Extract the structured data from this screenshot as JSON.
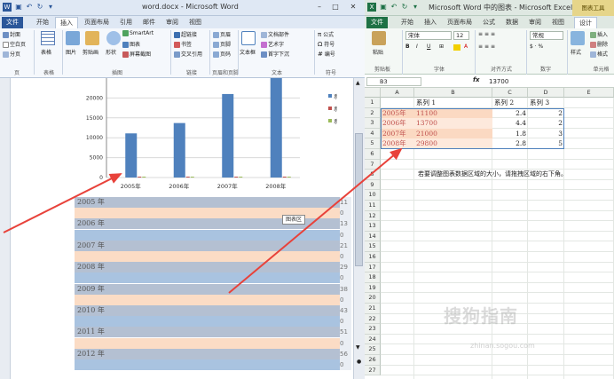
{
  "word": {
    "title": "word.docx - Microsoft Word",
    "tabs": [
      "文件",
      "开始",
      "插入",
      "页面布局",
      "引用",
      "邮件",
      "审阅",
      "视图"
    ],
    "active_tab": "插入",
    "ribbon": {
      "pages": {
        "items": [
          "封面",
          "空白页",
          "分页"
        ],
        "label": "页"
      },
      "table": {
        "items": [
          "表格"
        ],
        "label": "表格"
      },
      "illustrations": {
        "items": [
          "图片",
          "剪贴画",
          "形状",
          "SmartArt",
          "图表",
          "屏幕截图"
        ],
        "label": "插图"
      },
      "links": {
        "items": [
          "超链接",
          "书签",
          "交叉引用"
        ],
        "label": "链接"
      },
      "header_footer": {
        "items": [
          "页眉",
          "页脚",
          "页码"
        ],
        "label": "页眉和页脚"
      },
      "text": {
        "items": [
          "文本框",
          "文档部件",
          "艺术字",
          "首字下沉"
        ],
        "label": "文本"
      },
      "symbols": {
        "items": [
          "公式",
          "符号",
          "编号"
        ],
        "label": "符号"
      }
    },
    "chart": {
      "y_ticks": [
        "20000",
        "15000",
        "10000",
        "5000",
        "0"
      ],
      "x_ticks": [
        "2005年",
        "2006年",
        "2007年",
        "2008年"
      ]
    },
    "table_rows": [
      {
        "label": "2005 年",
        "right": "11"
      },
      {
        "label": "",
        "right": "0"
      },
      {
        "label": "2006 年",
        "right": "13"
      },
      {
        "label": "",
        "right": "0"
      },
      {
        "label": "2007 年",
        "right": "21"
      },
      {
        "label": "",
        "right": "0"
      },
      {
        "label": "2008 年",
        "right": "29"
      },
      {
        "label": "",
        "right": "0"
      },
      {
        "label": "2009 年",
        "right": "38"
      },
      {
        "label": "",
        "right": "0"
      },
      {
        "label": "2010 年",
        "right": "43"
      },
      {
        "label": "",
        "right": "0"
      },
      {
        "label": "2011 年",
        "right": "51"
      },
      {
        "label": "",
        "right": "0"
      },
      {
        "label": "2012 年",
        "right": "56"
      },
      {
        "label": "",
        "right": "0"
      }
    ],
    "tooltip": "图表区"
  },
  "excel": {
    "title": "Microsoft Word 中的图表 - Microsoft Excel",
    "tools_tab": "图表工具",
    "tabs": [
      "文件",
      "开始",
      "插入",
      "页面布局",
      "公式",
      "数据",
      "审阅",
      "视图",
      "设计"
    ],
    "ribbon": {
      "clipboard": {
        "items": [
          "粘贴"
        ],
        "label": "剪贴板"
      },
      "font": {
        "name": "宋体",
        "size": "12",
        "label": "字体"
      },
      "align": {
        "label": "对齐方式"
      },
      "number": {
        "format": "常规",
        "label": "数字"
      },
      "styles": {
        "items": [
          "样式"
        ]
      },
      "cells": {
        "items": [
          "插入",
          "删除",
          "格式"
        ],
        "label": "单元格"
      }
    },
    "name_box": "B3",
    "fx": "fx",
    "formula": "13700",
    "columns": [
      "A",
      "B",
      "C",
      "D",
      "E"
    ],
    "row_numbers": [
      "1",
      "2",
      "3",
      "4",
      "5",
      "6",
      "7",
      "8",
      "9",
      "10",
      "11",
      "12",
      "13",
      "14",
      "15",
      "16",
      "17",
      "18",
      "19",
      "20",
      "21",
      "22",
      "23",
      "24",
      "25",
      "26",
      "27"
    ],
    "header_row": [
      "",
      "系列 1",
      "系列 2",
      "系列 3"
    ],
    "data_rows": [
      {
        "a": "2005年",
        "b": "11100",
        "c": "2.4",
        "d": "2"
      },
      {
        "a": "2006年",
        "b": "13700",
        "c": "4.4",
        "d": "2"
      },
      {
        "a": "2007年",
        "b": "21000",
        "c": "1.8",
        "d": "3"
      },
      {
        "a": "2008年",
        "b": "29800",
        "c": "2.8",
        "d": "5"
      }
    ],
    "note": "若要调整图表数据区域的大小，请拖拽区域的右下角。"
  },
  "chart_data": {
    "type": "bar",
    "categories": [
      "2005年",
      "2006年",
      "2007年",
      "2008年"
    ],
    "series": [
      {
        "name": "系列 1",
        "values": [
          11100,
          13700,
          21000,
          29800
        ]
      },
      {
        "name": "系列 2",
        "values": [
          2.4,
          4.4,
          1.8,
          2.8
        ]
      },
      {
        "name": "系列 3",
        "values": [
          2,
          2,
          3,
          5
        ]
      }
    ],
    "ylim": [
      0,
      25000
    ],
    "grid": true,
    "legend": "right"
  },
  "watermark": {
    "main": "搜狗指南",
    "sub": "zhinan.sogou.com"
  },
  "colors": {
    "word_blue": "#2b579a",
    "excel_green": "#1e7145",
    "bar": "#4f81bd",
    "arrow": "#e8423a",
    "tools": "#e6d58a"
  }
}
